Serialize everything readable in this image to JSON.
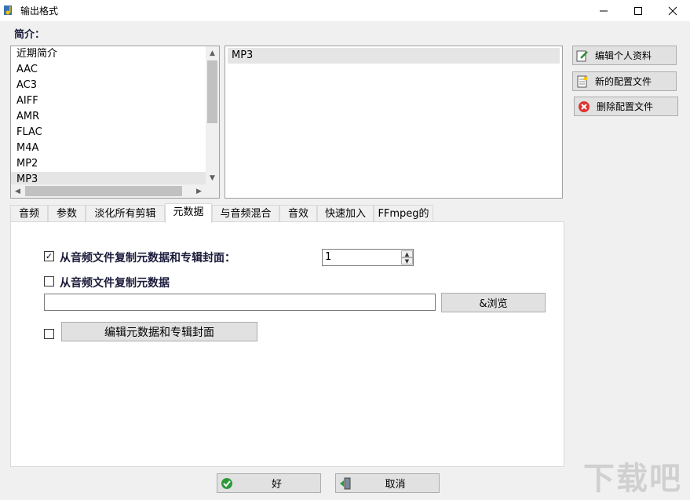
{
  "window": {
    "title": "输出格式"
  },
  "section": {
    "profiles_label": "简介："
  },
  "profiles": {
    "items": [
      "近期简介",
      "AAC",
      "AC3",
      "AIFF",
      "AMR",
      "FLAC",
      "M4A",
      "MP2",
      "MP3"
    ],
    "selected": "MP3"
  },
  "detail": {
    "selected_profile": "MP3"
  },
  "side_buttons": {
    "edit": "编辑个人资料",
    "new": "新的配置文件",
    "delete": "删除配置文件"
  },
  "tabs": [
    "音频",
    "参数",
    "淡化所有剪辑",
    "元数据",
    "与音频混合",
    "音效",
    "快速加入",
    "FFmpeg的"
  ],
  "active_tab": "元数据",
  "metadata": {
    "copy_with_cover_label": "从音频文件复制元数据和专辑封面：",
    "copy_with_cover_checked": true,
    "spin_value": "1",
    "copy_label": "从音频文件复制元数据",
    "copy_checked": false,
    "path_value": "",
    "browse_label": "&浏览",
    "edit_checked": false,
    "edit_button_label": "编辑元数据和专辑封面"
  },
  "footer": {
    "ok_label": "好",
    "cancel_label": "取消"
  },
  "watermark": "下载吧"
}
